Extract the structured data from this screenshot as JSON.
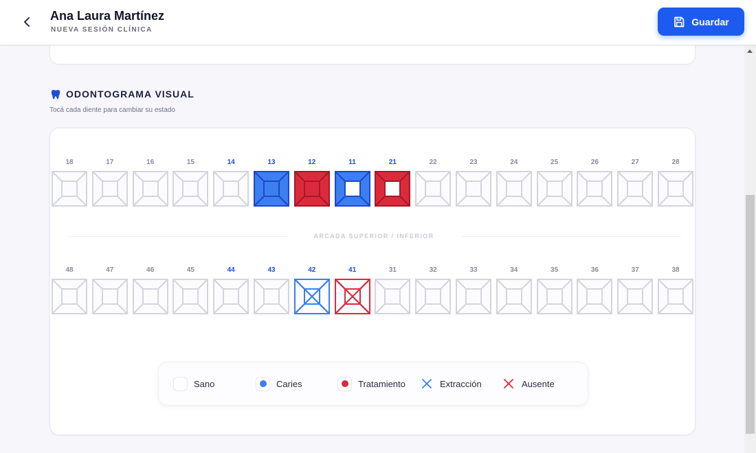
{
  "header": {
    "patient_name": "Ana Laura Martínez",
    "session_label": "NUEVA SESIÓN CLÍNICA",
    "save_label": "Guardar"
  },
  "odontogram": {
    "title": "ODONTOGRAMA VISUAL",
    "hint": "Tocá cada diente para cambiar su estado",
    "arch_label": "ARCADA SUPERIOR / INFERIOR",
    "upper_teeth": [
      {
        "number": "18",
        "state": "sano"
      },
      {
        "number": "17",
        "state": "sano"
      },
      {
        "number": "16",
        "state": "sano"
      },
      {
        "number": "15",
        "state": "sano"
      },
      {
        "number": "14",
        "state": "sano",
        "highlight": true
      },
      {
        "number": "13",
        "state": "caries"
      },
      {
        "number": "12",
        "state": "tratamiento"
      },
      {
        "number": "11",
        "state": "caries",
        "center_open": true
      },
      {
        "number": "21",
        "state": "tratamiento",
        "center_open": true
      },
      {
        "number": "22",
        "state": "sano"
      },
      {
        "number": "23",
        "state": "sano"
      },
      {
        "number": "24",
        "state": "sano"
      },
      {
        "number": "25",
        "state": "sano"
      },
      {
        "number": "26",
        "state": "sano"
      },
      {
        "number": "27",
        "state": "sano"
      },
      {
        "number": "28",
        "state": "sano"
      }
    ],
    "lower_teeth": [
      {
        "number": "48",
        "state": "sano"
      },
      {
        "number": "47",
        "state": "sano"
      },
      {
        "number": "46",
        "state": "sano"
      },
      {
        "number": "45",
        "state": "sano"
      },
      {
        "number": "44",
        "state": "sano",
        "highlight": true
      },
      {
        "number": "43",
        "state": "sano",
        "highlight": true
      },
      {
        "number": "42",
        "state": "extraccion"
      },
      {
        "number": "41",
        "state": "ausente"
      },
      {
        "number": "31",
        "state": "sano"
      },
      {
        "number": "32",
        "state": "sano"
      },
      {
        "number": "33",
        "state": "sano"
      },
      {
        "number": "34",
        "state": "sano"
      },
      {
        "number": "35",
        "state": "sano"
      },
      {
        "number": "36",
        "state": "sano"
      },
      {
        "number": "37",
        "state": "sano"
      },
      {
        "number": "38",
        "state": "sano"
      }
    ],
    "legend": [
      {
        "key": "sano",
        "label": "Sano"
      },
      {
        "key": "caries",
        "label": "Caries"
      },
      {
        "key": "tratamiento",
        "label": "Tratamiento"
      },
      {
        "key": "extraccion",
        "label": "Extracción"
      },
      {
        "key": "ausente",
        "label": "Ausente"
      }
    ]
  },
  "colors": {
    "accent": "#1d5bf0",
    "caries": "#3b7ff0",
    "caries_edge": "#1f47c8",
    "tratamiento": "#dc2a3c",
    "tratamiento_edge": "#a3192a",
    "outline": "#d4d4de"
  }
}
